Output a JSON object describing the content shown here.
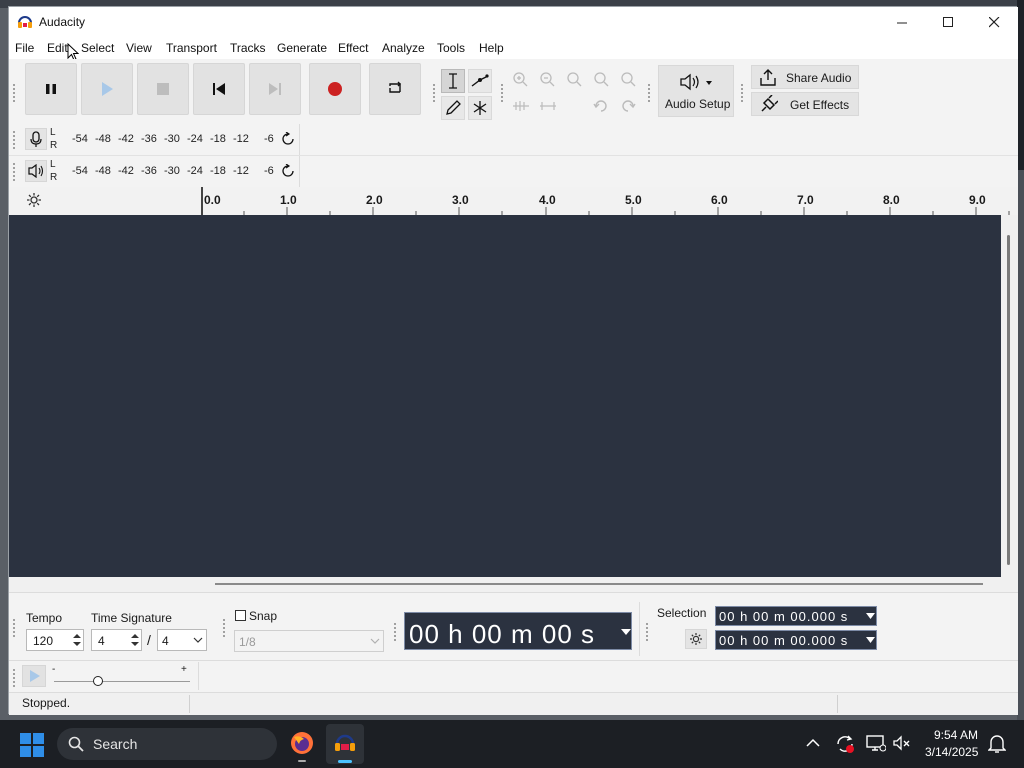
{
  "window": {
    "title": "Audacity"
  },
  "menu": [
    "File",
    "Edit",
    "Select",
    "View",
    "Transport",
    "Tracks",
    "Generate",
    "Effect",
    "Analyze",
    "Tools",
    "Help"
  ],
  "toolbar": {
    "audio_setup": "Audio Setup",
    "share_audio": "Share Audio",
    "get_effects": "Get Effects"
  },
  "meters": {
    "rec_channels": [
      "L",
      "R"
    ],
    "play_channels": [
      "L",
      "R"
    ],
    "scale": [
      "-54",
      "-48",
      "-42",
      "-36",
      "-30",
      "-24",
      "-18",
      "-12",
      "-6"
    ]
  },
  "ruler": {
    "ticks": [
      "0.0",
      "1.0",
      "2.0",
      "3.0",
      "4.0",
      "5.0",
      "6.0",
      "7.0",
      "8.0",
      "9.0"
    ]
  },
  "bottom": {
    "tempo_label": "Tempo",
    "tempo_value": "120",
    "time_signature_label": "Time Signature",
    "ts_numerator": "4",
    "ts_slash": "/",
    "ts_denominator": "4",
    "snap_label": "Snap",
    "snap_value": "1/8",
    "time_display": "00 h 00 m 00 s",
    "selection_label": "Selection",
    "selection_start": "00 h 00 m 00.000 s",
    "selection_end": "00 h 00 m 00.000 s",
    "speed_minus": "-",
    "speed_plus": "+"
  },
  "status": {
    "text": "Stopped."
  },
  "taskbar": {
    "search_placeholder": "Search",
    "time": "9:54 AM",
    "date": "3/14/2025"
  },
  "colors": {
    "track_bg": "#2b3240",
    "record_red": "#cc2222",
    "play_blue": "#a8c8e8",
    "taskbar_bg": "#1c1f24",
    "windows_blue": "#2f8ee8"
  }
}
